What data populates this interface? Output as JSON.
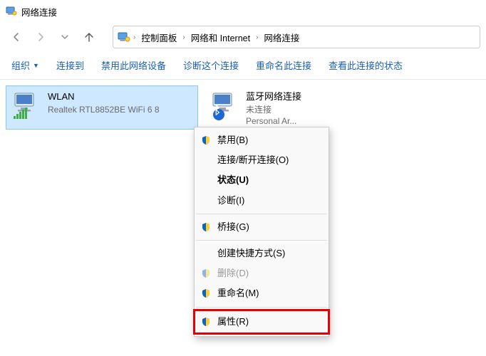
{
  "window": {
    "title": "网络连接"
  },
  "breadcrumb": {
    "root": "",
    "parts": [
      "控制面板",
      "网络和 Internet",
      "网络连接"
    ]
  },
  "toolbar": {
    "organize": "组织",
    "connect": "连接到",
    "disable": "禁用此网络设备",
    "diagnose": "诊断这个连接",
    "rename": "重命名此连接",
    "status": "查看此连接的状态"
  },
  "adapters": [
    {
      "name": "WLAN",
      "line2": "",
      "line3": "Realtek RTL8852BE WiFi 6 8",
      "selected": true,
      "kind": "wifi"
    },
    {
      "name": "蓝牙网络连接",
      "line2": "未连接",
      "line3": "Personal Ar...",
      "selected": false,
      "kind": "bluetooth"
    }
  ],
  "context_menu": {
    "items": [
      {
        "label": "禁用(B)",
        "shield": true
      },
      {
        "label": "连接/断开连接(O)"
      },
      {
        "label": "状态(U)",
        "bold": true
      },
      {
        "label": "诊断(I)"
      },
      {
        "sep": true
      },
      {
        "label": "桥接(G)",
        "shield": true
      },
      {
        "sep": true
      },
      {
        "label": "创建快捷方式(S)"
      },
      {
        "label": "删除(D)",
        "shield": true,
        "disabled": true
      },
      {
        "label": "重命名(M)",
        "shield": true
      },
      {
        "sep": true
      },
      {
        "label": "属性(R)",
        "shield": true,
        "highlight": true
      }
    ]
  },
  "colors": {
    "selection": "#cde8ff",
    "link": "#1a5fb4",
    "highlight_red": "#e60000"
  }
}
